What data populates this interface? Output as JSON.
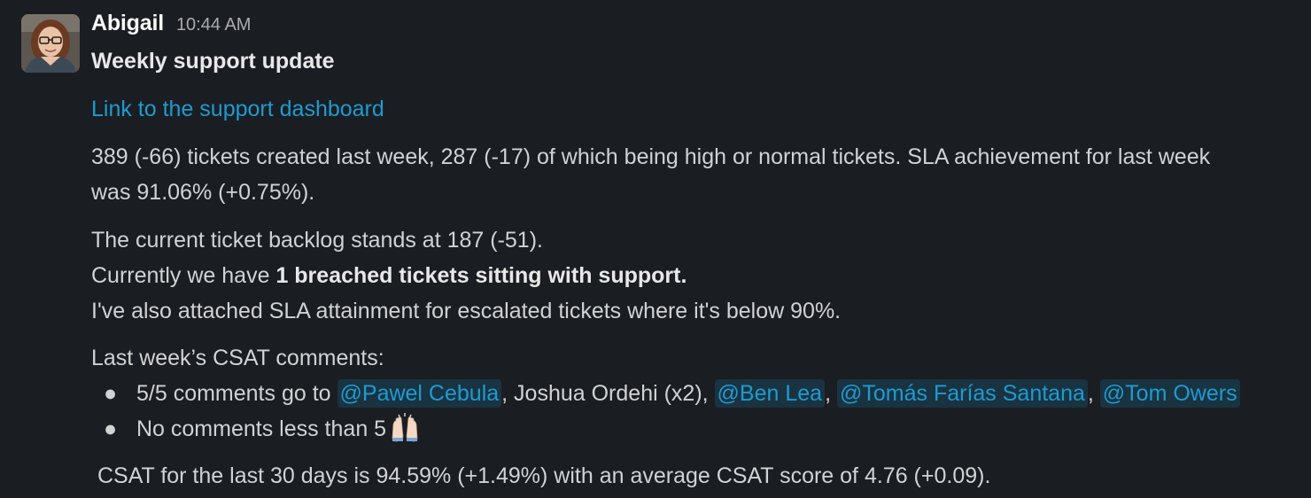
{
  "message": {
    "author": "Abigail",
    "timestamp": "10:44 AM",
    "title": "Weekly support update",
    "link_text": "Link to the support dashboard",
    "para1_line1": "389 (-66) tickets created last week, 287 (-17) of which being high or normal tickets. SLA achievement for last week",
    "para1_line2": "was 91.06% (+0.75%).",
    "para2_line1": "The current ticket backlog stands at 187 (-51).",
    "para2_line2_prefix": "Currently we have ",
    "para2_line2_bold": "1 breached tickets sitting with support.",
    "para2_line3": "I've also attached SLA attainment for escalated tickets where it's below 90%.",
    "para3": "Last week’s CSAT comments:",
    "bullet_marker": "●",
    "bullet1": {
      "prefix": "5/5 comments go to ",
      "mention1": "@Pawel Cebula",
      "sep1": ", Joshua Ordehi (x2), ",
      "mention2": "@Ben Lea",
      "sep2": ", ",
      "mention3": "@Tomás Farías Santana",
      "sep3": ", ",
      "mention4": "@Tom Owers"
    },
    "bullet2": {
      "text": "No comments less than 5",
      "emoji": "raised-hands-emoji"
    },
    "para4": "CSAT for the last 30 days is 94.59% (+1.49%) with an average CSAT score of 4.76 (+0.09)."
  },
  "colors": {
    "background": "#1a1d21",
    "text": "#d1d2d3",
    "link": "#1d9bd1",
    "timestamp": "#ababad",
    "author": "#f8f8f8"
  }
}
